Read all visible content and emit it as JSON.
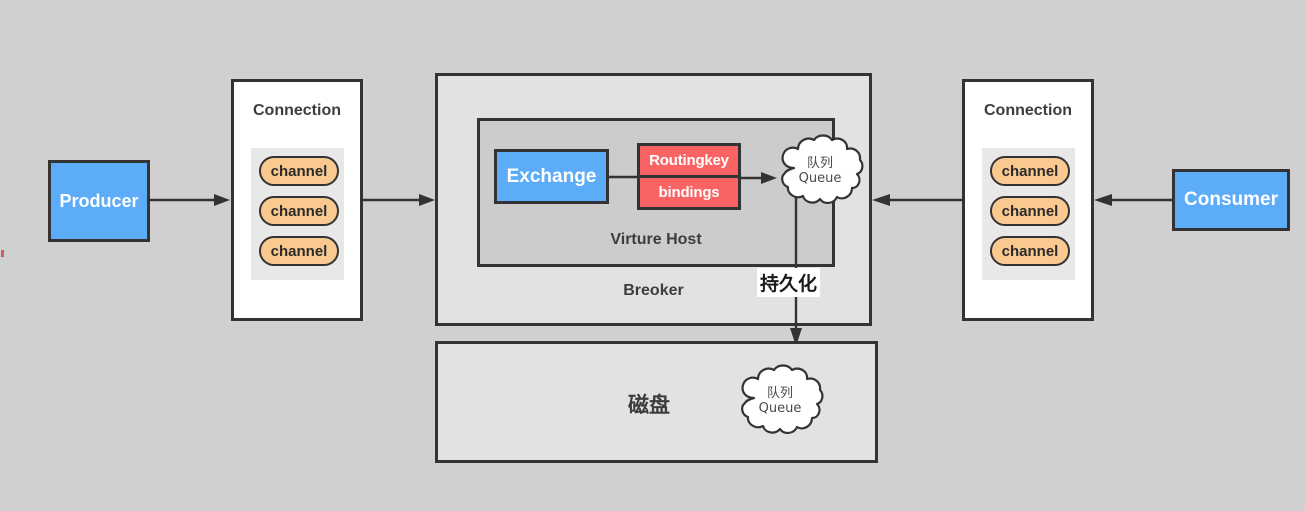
{
  "background_color": "#d0d0d0",
  "producer": {
    "label": "Producer",
    "color": "#5cacfa"
  },
  "consumer": {
    "label": "Consumer",
    "color": "#5cacfa"
  },
  "connection_left": {
    "title": "Connection",
    "channels": [
      "channel",
      "channel",
      "channel"
    ]
  },
  "connection_right": {
    "title": "Connection",
    "channels": [
      "channel",
      "channel",
      "channel"
    ]
  },
  "broker": {
    "title": "Breoker",
    "color": "#e2e2e2",
    "virture_host": {
      "title": "Virture Host",
      "color": "#cccccc",
      "exchange": {
        "label": "Exchange",
        "color": "#5cacfa"
      },
      "binding": {
        "routingkey_label": "Routingkey",
        "bindings_label": "bindings",
        "color": "#fa6363"
      },
      "queue": {
        "line1": "队列",
        "line2": "Queue"
      }
    }
  },
  "persistence": {
    "label": "持久化"
  },
  "disk": {
    "label": "磁盘",
    "color": "#e2e2e2",
    "queue": {
      "line1": "队列",
      "line2": "Queue"
    }
  },
  "channel_pill_color": "#fac98f",
  "stroke_color": "#333333"
}
